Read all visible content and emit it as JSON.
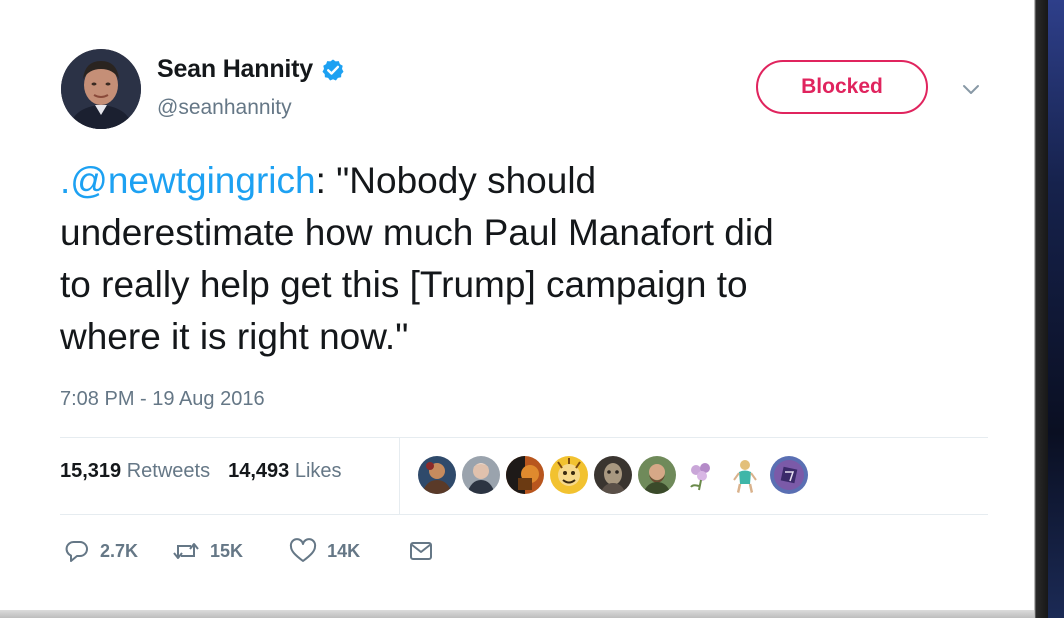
{
  "user": {
    "name": "Sean Hannity",
    "handle": "@seanhannity",
    "verified": true
  },
  "follow_button": {
    "label": "Blocked",
    "color": "#e0245e"
  },
  "tweet": {
    "mention": ".@newtgingrich",
    "lines": [
      ": \"Nobody should",
      "underestimate how much Paul Manafort did",
      "to really help get this [Trump] campaign to",
      "where it is right now.\""
    ],
    "mention_color": "#1da1f2",
    "timestamp": "7:08 PM - 19 Aug 2016"
  },
  "stats": {
    "retweets_count": "15,319",
    "retweets_label": "Retweets",
    "likes_count": "14,493",
    "likes_label": "Likes"
  },
  "liker_avatars": [
    "avatar-1",
    "avatar-2",
    "avatar-3",
    "avatar-4",
    "avatar-5",
    "avatar-6",
    "avatar-7",
    "avatar-8",
    "avatar-9"
  ],
  "actions": {
    "reply_count": "2.7K",
    "retweet_count": "15K",
    "like_count": "14K",
    "reply_icon": "reply-icon",
    "retweet_icon": "retweet-icon",
    "like_icon": "heart-icon",
    "message_icon": "envelope-icon"
  }
}
